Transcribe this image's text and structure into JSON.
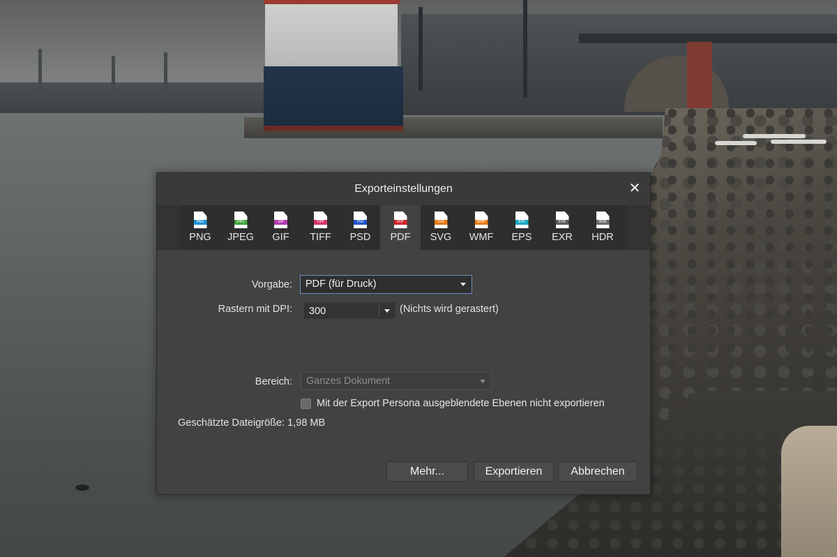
{
  "dialog": {
    "title": "Exporteinstellungen",
    "close_glyph": "✕"
  },
  "formats": [
    {
      "label": "PNG",
      "badge": "PNG",
      "color": "#1e90d6",
      "active": false
    },
    {
      "label": "JPEG",
      "badge": "JPEG",
      "color": "#3aa335",
      "active": false
    },
    {
      "label": "GIF",
      "badge": "GIF",
      "color": "#b13bb0",
      "active": false
    },
    {
      "label": "TIFF",
      "badge": "TIFF",
      "color": "#d9346a",
      "active": false
    },
    {
      "label": "PSD",
      "badge": "PSD",
      "color": "#1f54c9",
      "active": false
    },
    {
      "label": "PDF",
      "badge": "PDF",
      "color": "#d1262b",
      "active": true
    },
    {
      "label": "SVG",
      "badge": "SVG",
      "color": "#e8780f",
      "active": false
    },
    {
      "label": "WMF",
      "badge": "WMF",
      "color": "#ee7a15",
      "active": false
    },
    {
      "label": "EPS",
      "badge": "EPS",
      "color": "#18a6c2",
      "active": false
    },
    {
      "label": "EXR",
      "badge": "EXR",
      "color": "#5c5c5c",
      "active": false
    },
    {
      "label": "HDR",
      "badge": "HDR",
      "color": "#6a6a6a",
      "active": false
    }
  ],
  "form": {
    "preset_label": "Vorgabe:",
    "preset_value": "PDF (für Druck)",
    "dpi_label": "Rastern mit DPI:",
    "dpi_value": "300",
    "dpi_note": "(Nichts wird gerastert)",
    "range_label": "Bereich:",
    "range_value": "Ganzes Dokument",
    "hidden_layers_label": "Mit der Export Persona ausgeblendete Ebenen nicht exportieren",
    "hidden_layers_checked": false,
    "filesize_label": "Geschätzte Dateigröße:",
    "filesize_value": "1,98 MB"
  },
  "buttons": {
    "more": "Mehr...",
    "export": "Exportieren",
    "cancel": "Abbrechen"
  },
  "colors": {
    "dialog_bg": "#424242",
    "focus_border": "#6a8fbf"
  }
}
